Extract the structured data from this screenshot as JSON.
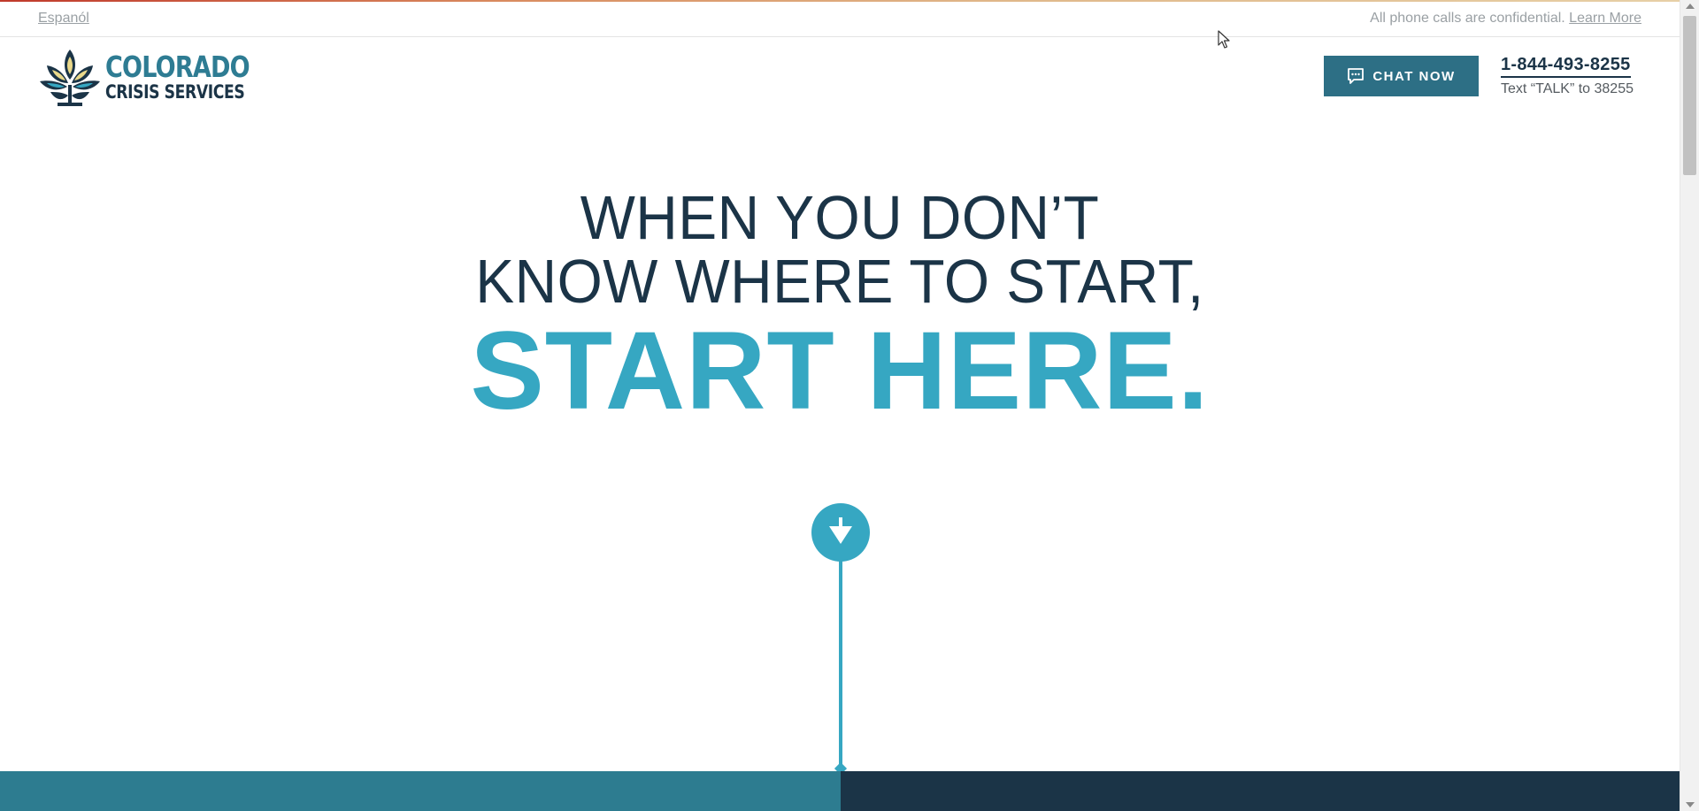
{
  "utility": {
    "language_link": "Espanól",
    "confidential_text": "All phone calls are confidential.",
    "learn_more": "Learn More"
  },
  "logo": {
    "line1": "COLORADO",
    "line2": "CRISIS SERVICES"
  },
  "header": {
    "chat_label": "CHAT NOW",
    "phone": "1-844-493-8255",
    "text_line": "Text “TALK” to 38255"
  },
  "hero": {
    "line1": "WHEN YOU DON’T",
    "line2": "KNOW WHERE TO START,",
    "line3": "START HERE."
  },
  "colors": {
    "navy": "#1b3447",
    "teal": "#2d6f85",
    "accent": "#36a7c2"
  },
  "icons": {
    "chat": "chat-bubble-icon",
    "scroll": "arrow-down-icon",
    "logo": "lotus-logo-icon"
  }
}
